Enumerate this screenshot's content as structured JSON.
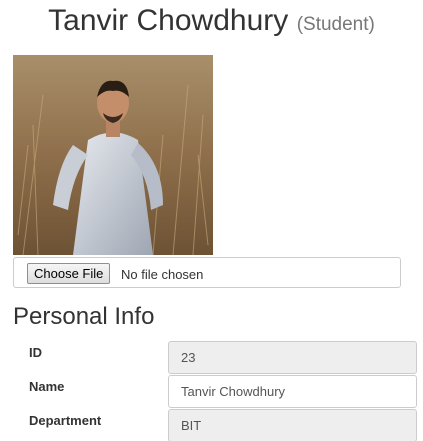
{
  "header": {
    "name": "Tanvir Chowdhury",
    "role": "(Student)"
  },
  "photo": {
    "icon": "profile-photo"
  },
  "upload": {
    "button_label": "Choose File",
    "status": "No file chosen"
  },
  "personal_info": {
    "title": "Personal Info",
    "fields": [
      {
        "label": "ID",
        "value": "23"
      },
      {
        "label": "Name",
        "value": "Tanvir Chowdhury"
      },
      {
        "label": "Department",
        "value": "BIT"
      }
    ]
  }
}
